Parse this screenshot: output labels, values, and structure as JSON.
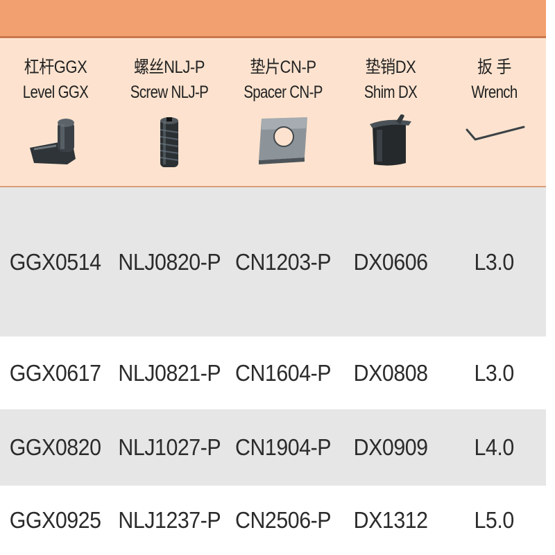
{
  "header": {
    "columns": [
      {
        "cn": "杠杆GGX",
        "en": "Level GGX",
        "icon": "lever-icon"
      },
      {
        "cn": "螺丝NLJ-P",
        "en": "Screw NLJ-P",
        "icon": "screw-icon"
      },
      {
        "cn": "垫片CN-P",
        "en": "Spacer CN-P",
        "icon": "spacer-icon"
      },
      {
        "cn": "垫销DX",
        "en": "Shim DX",
        "icon": "shim-icon"
      },
      {
        "cn": "扳 手",
        "en": "Wrench",
        "icon": "wrench-icon"
      }
    ]
  },
  "rows": [
    [
      "GGX0514",
      "NLJ0820-P",
      "CN1203-P",
      "DX0606",
      "L3.0"
    ],
    [
      "GGX0617",
      "NLJ0821-P",
      "CN1604-P",
      "DX0808",
      "L3.0"
    ],
    [
      "GGX0820",
      "NLJ1027-P",
      "CN1904-P",
      "DX0909",
      "L4.0"
    ],
    [
      "GGX0925",
      "NLJ1237-P",
      "CN2506-P",
      "DX1312",
      "L5.0"
    ]
  ],
  "colors": {
    "top_bar": "#f2a06f",
    "header_bg": "#fde3cf",
    "row_gray": "#e6e6e6",
    "row_white": "#ffffff"
  }
}
